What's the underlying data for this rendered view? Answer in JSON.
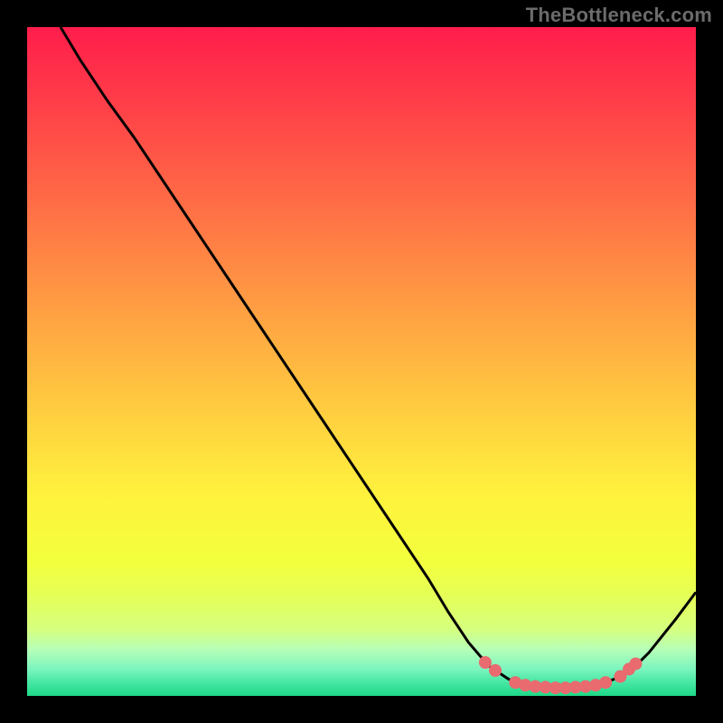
{
  "attribution": "TheBottleneck.com",
  "colors": {
    "dot_fill": "#e96a6f",
    "curve_stroke": "#000000"
  },
  "gradient_stops": [
    {
      "offset": 0.0,
      "color": "#ff1d4b"
    },
    {
      "offset": 0.1,
      "color": "#ff3a49"
    },
    {
      "offset": 0.2,
      "color": "#ff5947"
    },
    {
      "offset": 0.3,
      "color": "#ff7845"
    },
    {
      "offset": 0.4,
      "color": "#ff9843"
    },
    {
      "offset": 0.5,
      "color": "#ffb741"
    },
    {
      "offset": 0.6,
      "color": "#ffd53f"
    },
    {
      "offset": 0.7,
      "color": "#fff23d"
    },
    {
      "offset": 0.8,
      "color": "#f2ff3d"
    },
    {
      "offset": 0.85,
      "color": "#e5ff57"
    },
    {
      "offset": 0.9,
      "color": "#d6ff7e"
    },
    {
      "offset": 0.93,
      "color": "#b7ffb7"
    },
    {
      "offset": 0.96,
      "color": "#7bf5be"
    },
    {
      "offset": 0.98,
      "color": "#46e6a3"
    },
    {
      "offset": 1.0,
      "color": "#1ed987"
    }
  ],
  "chart_data": {
    "type": "line",
    "title": "",
    "xlabel": "",
    "ylabel": "",
    "xlim": [
      0,
      100
    ],
    "ylim": [
      0,
      100
    ],
    "curve": [
      {
        "x": 5.0,
        "y": 100.0
      },
      {
        "x": 8.0,
        "y": 95.0
      },
      {
        "x": 12.0,
        "y": 89.0
      },
      {
        "x": 16.0,
        "y": 83.5
      },
      {
        "x": 20.0,
        "y": 77.5
      },
      {
        "x": 25.0,
        "y": 70.0
      },
      {
        "x": 30.0,
        "y": 62.5
      },
      {
        "x": 35.0,
        "y": 55.0
      },
      {
        "x": 40.0,
        "y": 47.5
      },
      {
        "x": 45.0,
        "y": 40.0
      },
      {
        "x": 50.0,
        "y": 32.5
      },
      {
        "x": 55.0,
        "y": 25.0
      },
      {
        "x": 60.0,
        "y": 17.5
      },
      {
        "x": 63.0,
        "y": 12.5
      },
      {
        "x": 66.0,
        "y": 8.0
      },
      {
        "x": 69.0,
        "y": 4.5
      },
      {
        "x": 72.0,
        "y": 2.5
      },
      {
        "x": 75.0,
        "y": 1.5
      },
      {
        "x": 78.0,
        "y": 1.2
      },
      {
        "x": 81.0,
        "y": 1.2
      },
      {
        "x": 84.0,
        "y": 1.5
      },
      {
        "x": 87.0,
        "y": 2.2
      },
      {
        "x": 89.0,
        "y": 3.0
      },
      {
        "x": 91.0,
        "y": 4.5
      },
      {
        "x": 93.0,
        "y": 6.5
      },
      {
        "x": 95.0,
        "y": 9.0
      },
      {
        "x": 97.0,
        "y": 11.5
      },
      {
        "x": 100.0,
        "y": 15.5
      }
    ],
    "points": [
      {
        "x": 68.5,
        "y": 5.0
      },
      {
        "x": 70.0,
        "y": 3.8
      },
      {
        "x": 73.0,
        "y": 2.0
      },
      {
        "x": 74.5,
        "y": 1.6
      },
      {
        "x": 76.0,
        "y": 1.4
      },
      {
        "x": 77.5,
        "y": 1.3
      },
      {
        "x": 79.0,
        "y": 1.2
      },
      {
        "x": 80.5,
        "y": 1.2
      },
      {
        "x": 82.0,
        "y": 1.3
      },
      {
        "x": 83.5,
        "y": 1.4
      },
      {
        "x": 85.0,
        "y": 1.6
      },
      {
        "x": 86.5,
        "y": 2.0
      },
      {
        "x": 88.7,
        "y": 2.9
      },
      {
        "x": 90.0,
        "y": 4.0
      },
      {
        "x": 91.0,
        "y": 4.8
      }
    ]
  }
}
